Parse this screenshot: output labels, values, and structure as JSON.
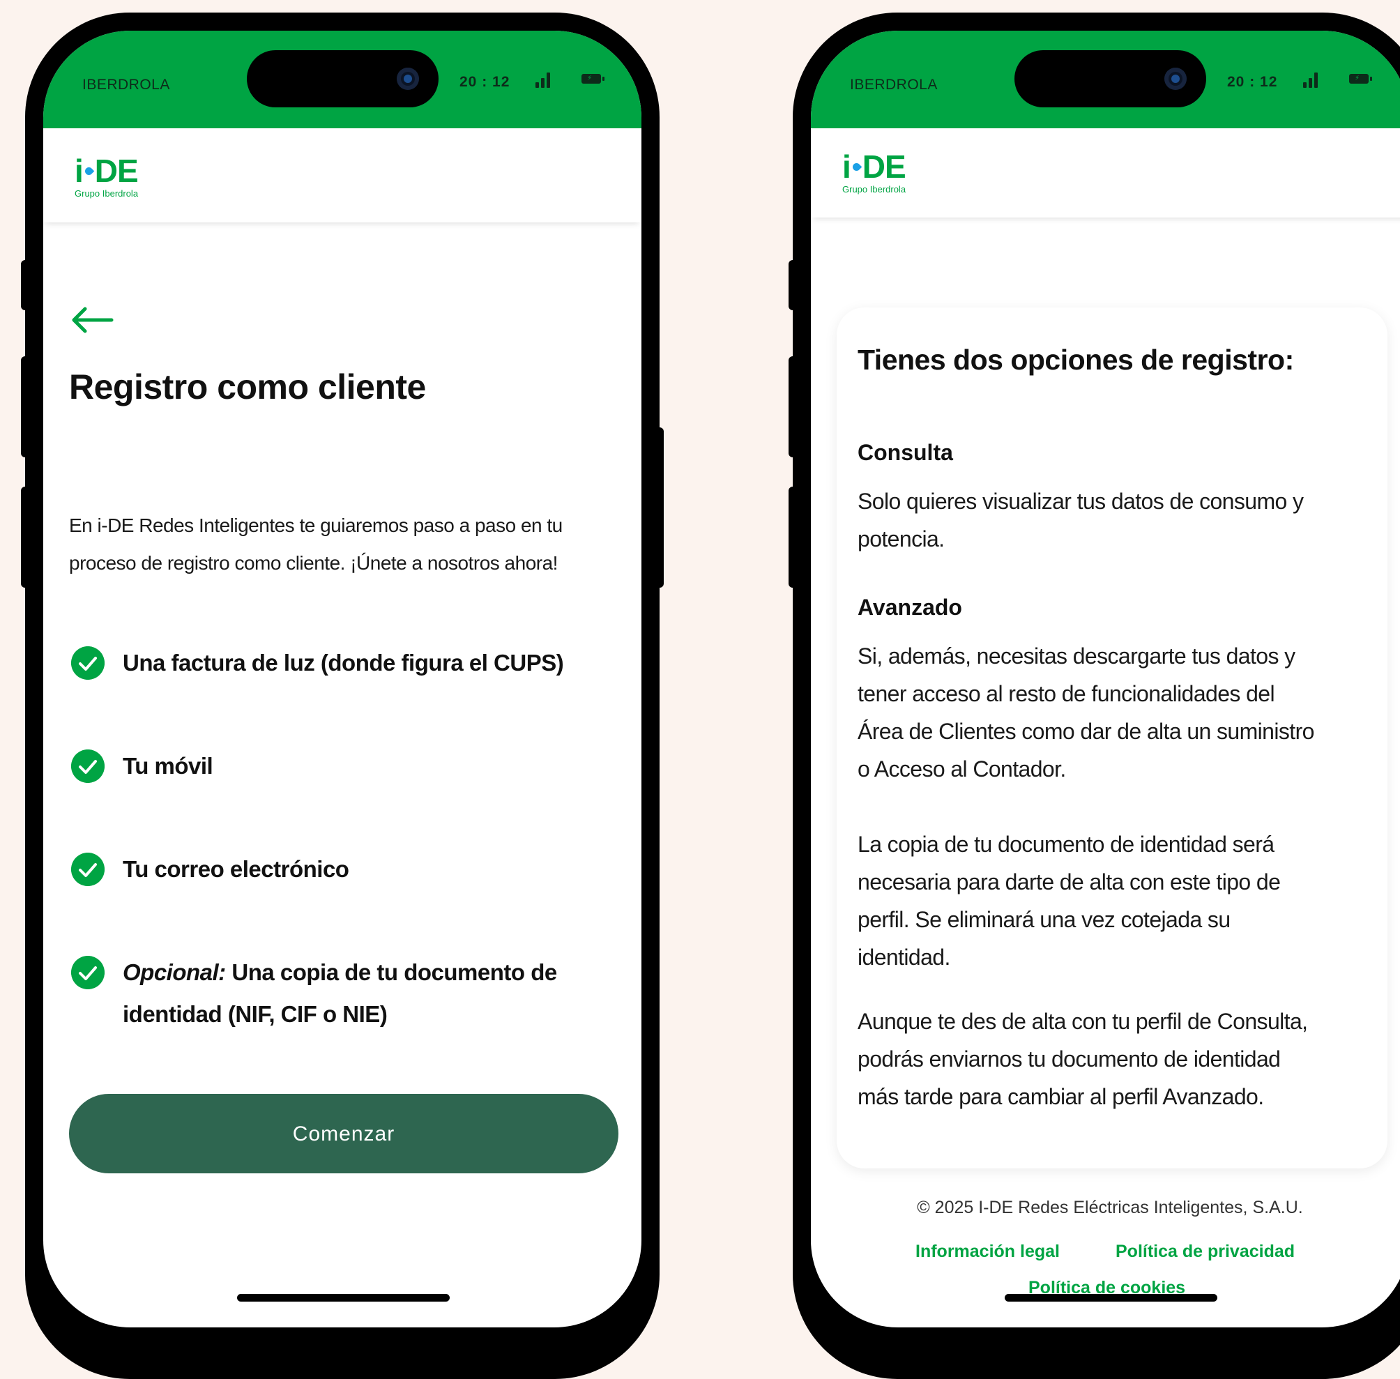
{
  "status_bar": {
    "carrier": "IBERDROLA",
    "time": "20 : 12"
  },
  "brand": {
    "logo_left": "i",
    "logo_right": "DE",
    "logo_sub": "Grupo Iberdrola",
    "colors": {
      "green": "#00a443",
      "dark_green": "#2e6650",
      "blue_dot": "#1aa0e6",
      "background": "#fcf3ee"
    }
  },
  "screen1": {
    "back_icon": "arrow-left-icon",
    "title": "Registro como cliente",
    "intro_line1": "En i-DE Redes Inteligentes te guiaremos paso a paso en tu",
    "intro_line2": "proceso de registro como cliente. ¡Únete a nosotros ahora!",
    "requirements": [
      {
        "text": "Una factura de luz (donde figura el CUPS)"
      },
      {
        "text": "Tu móvil"
      },
      {
        "text": "Tu correo electrónico"
      },
      {
        "prefix": "Opcional:",
        "line1": " Una copia de tu documento de",
        "line2": "identidad (NIF, CIF o NIE)"
      }
    ],
    "start_button": "Comenzar"
  },
  "screen2": {
    "title": "Tienes dos opciones de registro:",
    "consulta": {
      "heading": "Consulta",
      "line1": "Solo quieres visualizar tus datos de consumo y",
      "line2": "potencia."
    },
    "avanzado": {
      "heading": "Avanzado",
      "line1": "Si, además, necesitas descargarte tus datos y",
      "line2": "tener acceso al resto de funcionalidades del",
      "line3": "Área de Clientes como dar de alta un suministro",
      "line4": "o Acceso al Contador."
    },
    "identity_note": {
      "line1": "La copia de tu documento de identidad será",
      "line2": "necesaria para darte de alta con este tipo de",
      "line3": "perfil. Se eliminará una vez cotejada su",
      "line4": "identidad."
    },
    "later_note": {
      "line1": "Aunque te des de alta con tu perfil de Consulta,",
      "line2": "podrás enviarnos tu documento de identidad",
      "line3": "más tarde para cambiar al perfil Avanzado."
    },
    "footer": {
      "copyright": "© 2025 I-DE Redes Eléctricas Inteligentes, S.A.U.",
      "legal": "Información legal",
      "privacy": "Política de privacidad",
      "cookies": "Política de cookies"
    }
  }
}
